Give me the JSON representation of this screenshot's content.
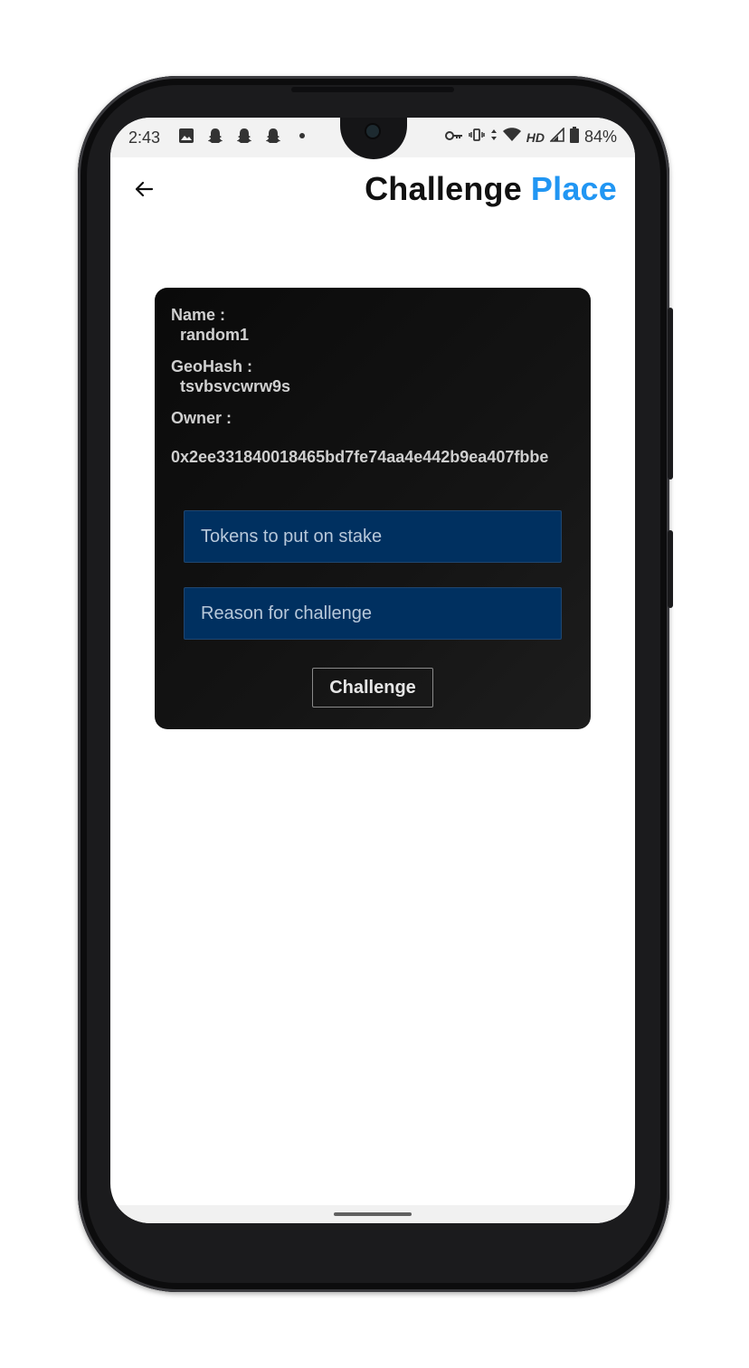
{
  "status_bar": {
    "time": "2:43",
    "network_label": "HD",
    "battery": "84%",
    "icons_left": [
      "image-icon",
      "snapchat-icon",
      "snapchat-icon",
      "snapchat-icon",
      "dot-icon"
    ],
    "icons_right": [
      "vpn-key-icon",
      "vibrate-icon",
      "data-arrows-icon",
      "wifi-icon",
      "signal-icon",
      "battery-icon"
    ]
  },
  "app_bar": {
    "title_part1": "Challenge",
    "title_part2": "Place",
    "accent_color": "#2196f3"
  },
  "card": {
    "name_label": "Name :",
    "name_value": "random1",
    "geohash_label": "GeoHash :",
    "geohash_value": "tsvbsvcwrw9s",
    "owner_label": "Owner :",
    "owner_value": "0x2ee331840018465bd7fe74aa4e442b9ea407fbbe",
    "tokens_placeholder": "Tokens to put on stake",
    "reason_placeholder": "Reason for challenge",
    "challenge_button": "Challenge",
    "field_color": "#003060"
  }
}
